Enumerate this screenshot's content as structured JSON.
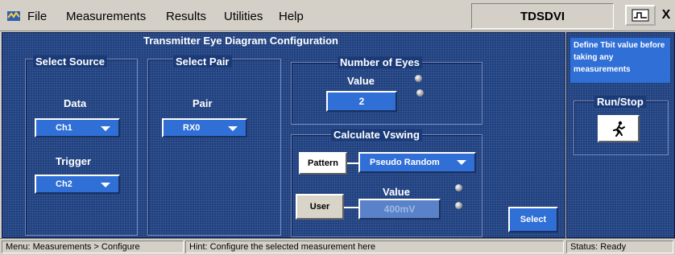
{
  "menubar": {
    "items": [
      "File",
      "Measurements",
      "Results",
      "Utilities",
      "Help"
    ],
    "app_title": "TDSDVI",
    "close_label": "X"
  },
  "panel": {
    "title": "Transmitter Eye Diagram Configuration",
    "select_source": {
      "title": "Select Source",
      "data_label": "Data",
      "data_value": "Ch1",
      "trigger_label": "Trigger",
      "trigger_value": "Ch2"
    },
    "select_pair": {
      "title": "Select Pair",
      "pair_label": "Pair",
      "pair_value": "RX0"
    },
    "number_of_eyes": {
      "title": "Number of Eyes",
      "value_label": "Value",
      "value": "2"
    },
    "vswing": {
      "title": "Calculate Vswing",
      "pattern_label": "Pattern",
      "pattern_value": "Pseudo Random",
      "value_label": "Value",
      "user_label": "User",
      "user_value": "400mV"
    },
    "select_button": "Select"
  },
  "side": {
    "info": "Define Tbit value before taking any measurements",
    "run_stop_title": "Run/Stop",
    "run_icon": "running-man-icon"
  },
  "status": {
    "menu_path": "Menu: Measurements > Configure",
    "hint": "Hint: Configure the selected measurement here",
    "status": "Status: Ready"
  },
  "colors": {
    "panel_bg": "#1a3a78",
    "control_blue": "#2f6fd6",
    "chrome": "#d4d0c8"
  }
}
